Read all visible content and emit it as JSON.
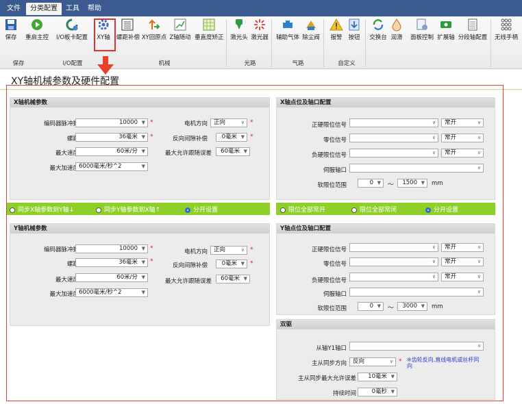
{
  "menu": {
    "file": "文件",
    "config": "分类配置",
    "tools": "工具",
    "help": "帮助"
  },
  "ribbon": {
    "buttons": {
      "save": "保存",
      "restart": "重启主控",
      "io_board": "I/O板卡配置",
      "xy": "XY轴",
      "screw": "螺距补偿",
      "xy_origin": "XY回原点",
      "z_follow": "Z轴随动",
      "vertical": "垂直度矫正",
      "laser_head": "激光头",
      "laser": "激光器",
      "aux_gas": "辅助气体",
      "dust": "除尘阀",
      "alarm": "报警",
      "button": "按钮",
      "exchange": "交换台",
      "lube": "润滑",
      "panel": "面板控制",
      "ext_axis": "扩展轴",
      "seg_axis": "分段轴配置",
      "wireless": "无线手柄"
    },
    "groups": {
      "save": "保存",
      "io": "I/O配置",
      "machine": "机械",
      "laser": "光路",
      "gas": "气路",
      "custom": "自定义"
    }
  },
  "page_title": "XY轴机械参数及硬件配置",
  "x_mech": {
    "title": "X轴机械参数",
    "enc_label": "编码器脉冲数",
    "enc": "10000",
    "pitch_label": "螺距",
    "pitch": "36毫米",
    "maxv_label": "最大速度",
    "maxv": "60米/分",
    "maxa_label": "最大加速度",
    "maxa": "6000毫米/秒^2",
    "dir_label": "电机方向",
    "dir": "正向",
    "backlash_label": "反向间隙补偿",
    "backlash": "0毫米",
    "err_label": "最大允许跟随误差",
    "err": "60毫米"
  },
  "x_io": {
    "title": "X轴点位及轴口配置",
    "pos_label": "正硬限位信号",
    "pos_mode": "常开",
    "zero_label": "零位信号",
    "zero_mode": "常开",
    "neg_label": "负硬限位信号",
    "neg_mode": "常开",
    "servo_label": "伺服轴口",
    "range_label": "软限位范围",
    "range_min": "0",
    "range_sep": "～",
    "range_max": "1500",
    "unit": "mm"
  },
  "sync": {
    "opt1": "同步X轴参数到Y轴↓",
    "opt2": "同步Y轴参数到X轴↑",
    "opt3": "分开设置"
  },
  "limit": {
    "opt1": "限位全部常开",
    "opt2": "限位全部常闭",
    "opt3": "分开设置"
  },
  "y_mech": {
    "title": "Y轴机械参数",
    "enc_label": "编码器脉冲数",
    "enc": "10000",
    "pitch_label": "螺距",
    "pitch": "36毫米",
    "maxv_label": "最大速度",
    "maxv": "60米/分",
    "maxa_label": "最大加速度",
    "maxa": "6000毫米/秒^2",
    "dir_label": "电机方向",
    "dir": "正向",
    "backlash_label": "反向间隙补偿",
    "backlash": "0毫米",
    "err_label": "最大允许跟随误差",
    "err": "60毫米"
  },
  "y_io": {
    "title": "Y轴点位及轴口配置",
    "pos_label": "正硬限位信号",
    "pos_mode": "常开",
    "zero_label": "零位信号",
    "zero_mode": "常开",
    "neg_label": "负硬限位信号",
    "neg_mode": "常开",
    "servo_label": "伺服轴口",
    "range_label": "软限位范围",
    "range_min": "0",
    "range_sep": "～",
    "range_max": "3000",
    "unit": "mm"
  },
  "dual": {
    "title": "双驱",
    "y1_label": "从轴Y1轴口",
    "dir_label": "主从同步方向",
    "dir": "反向",
    "note": "※齿轮反向,直线电机或丝杆同向",
    "err_label": "主从同步最大允许误差",
    "err": "10毫米",
    "time_label": "持续时间",
    "time": "0毫秒"
  }
}
